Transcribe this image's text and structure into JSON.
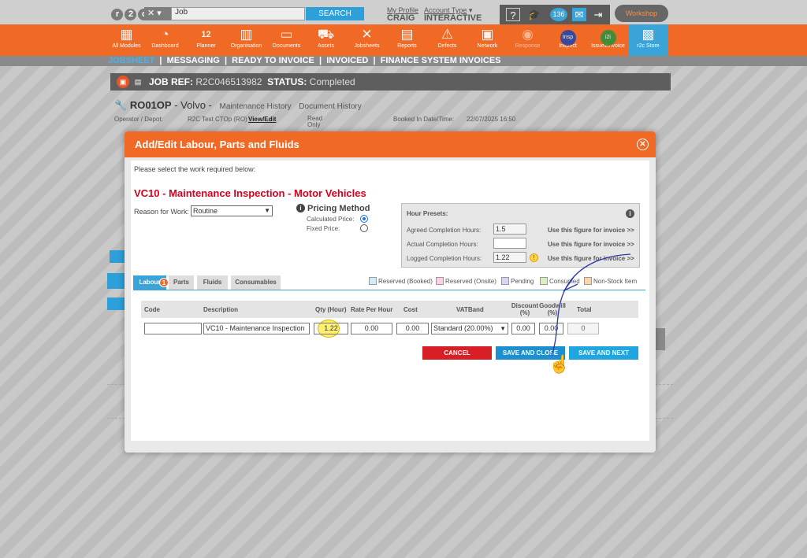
{
  "topbar": {
    "logo_text": "r2c",
    "search_value": "Job",
    "search_button": "SEARCH",
    "my_profile_label": "My Profile",
    "user_name": "CRAIG",
    "account_type_label": "Account Type",
    "account_type_value": "INTERACTIVE",
    "notification_count": "136",
    "workshop_label": "Workshop"
  },
  "nav": {
    "items": [
      {
        "label": "All Modules",
        "icon": "grid-icon"
      },
      {
        "label": "Dashboard",
        "icon": "gauge-icon"
      },
      {
        "label": "Planner",
        "icon": "calendar-icon",
        "badge": "12"
      },
      {
        "label": "Organisation",
        "icon": "building-icon"
      },
      {
        "label": "Documents",
        "icon": "folder-icon"
      },
      {
        "label": "Assets",
        "icon": "truck-icon"
      },
      {
        "label": "Jobsheets",
        "icon": "tools-icon"
      },
      {
        "label": "Reports",
        "icon": "clipboard-icon"
      },
      {
        "label": "Defects",
        "icon": "warning-icon"
      },
      {
        "label": "Network",
        "icon": "contact-icon"
      },
      {
        "label": "Response",
        "icon": "response-icon"
      },
      {
        "label": "Inspect",
        "icon": "inspect-icon"
      },
      {
        "label": "Issue2Invoice",
        "icon": "i2i-icon"
      },
      {
        "label": "r2c Store",
        "icon": "store-icon"
      }
    ],
    "subnav": [
      "JOBSHEET",
      "MESSAGING",
      "READY TO INVOICE",
      "INVOICED",
      "FINANCE SYSTEM INVOICES"
    ]
  },
  "page": {
    "job_ref_label": "JOB REF:",
    "job_ref_value": "R2C046513982",
    "status_label": "STATUS:",
    "status_value": "Completed",
    "registration": "RO01OP",
    "make": "Volvo",
    "maintenance_history": "Maintenance History",
    "document_history": "Document History",
    "operator_label": "Operator / Depot:",
    "operator_value": "R2C Test CTOp (RO)",
    "view_edit": "View/Edit",
    "read_only": "Read Only",
    "booked_label": "Booked In Date/Time:",
    "booked_value": "22/07/2025 16:50"
  },
  "modal": {
    "title": "Add/Edit Labour, Parts and Fluids",
    "instruction": "Please select the work required below:",
    "work_title": "VC10 - Maintenance Inspection - Motor Vehicles",
    "reason_label": "Reason for Work:",
    "reason_value": "Routine",
    "pricing_method_title": "Pricing Method",
    "calculated_price_label": "Calculated Price:",
    "fixed_price_label": "Fixed Price:",
    "presets": {
      "title": "Hour Presets:",
      "agreed_label": "Agreed Completion Hours:",
      "agreed_value": "1.5",
      "actual_label": "Actual Completion Hours:",
      "actual_value": "",
      "logged_label": "Logged Completion Hours:",
      "logged_value": "1.22",
      "use_figure": "Use this figure for invoice >>"
    },
    "tabs": [
      "Labour",
      "Parts",
      "Fluids",
      "Consumables"
    ],
    "labour_badge": "1",
    "legend": [
      "Reserved (Booked)",
      "Reserved (Onsite)",
      "Pending",
      "Consumed",
      "Non-Stock Item"
    ],
    "legend_colors": [
      "#cfeefc",
      "#fbd0e8",
      "#d6d6f7",
      "#d5f2c0",
      "#fbd6a6"
    ],
    "grid_headers": {
      "code": "Code",
      "description": "Description",
      "qty": "Qty (Hour)",
      "rate": "Rate Per Hour",
      "cost": "Cost",
      "vatband": "VATBand",
      "discount": "Discount (%)",
      "goodwill": "Goodwill (%)",
      "total": "Total"
    },
    "row": {
      "code": "",
      "description": "VC10 - Maintenance Inspection",
      "qty": "1.22",
      "rate": "0.00",
      "cost": "0.00",
      "vatband": "Standard (20.00%)",
      "discount": "0.00",
      "goodwill": "0.00",
      "total": "0"
    },
    "buttons": {
      "cancel": "CANCEL",
      "save_close": "SAVE AND CLOSE",
      "save_next": "SAVE AND NEXT"
    }
  }
}
